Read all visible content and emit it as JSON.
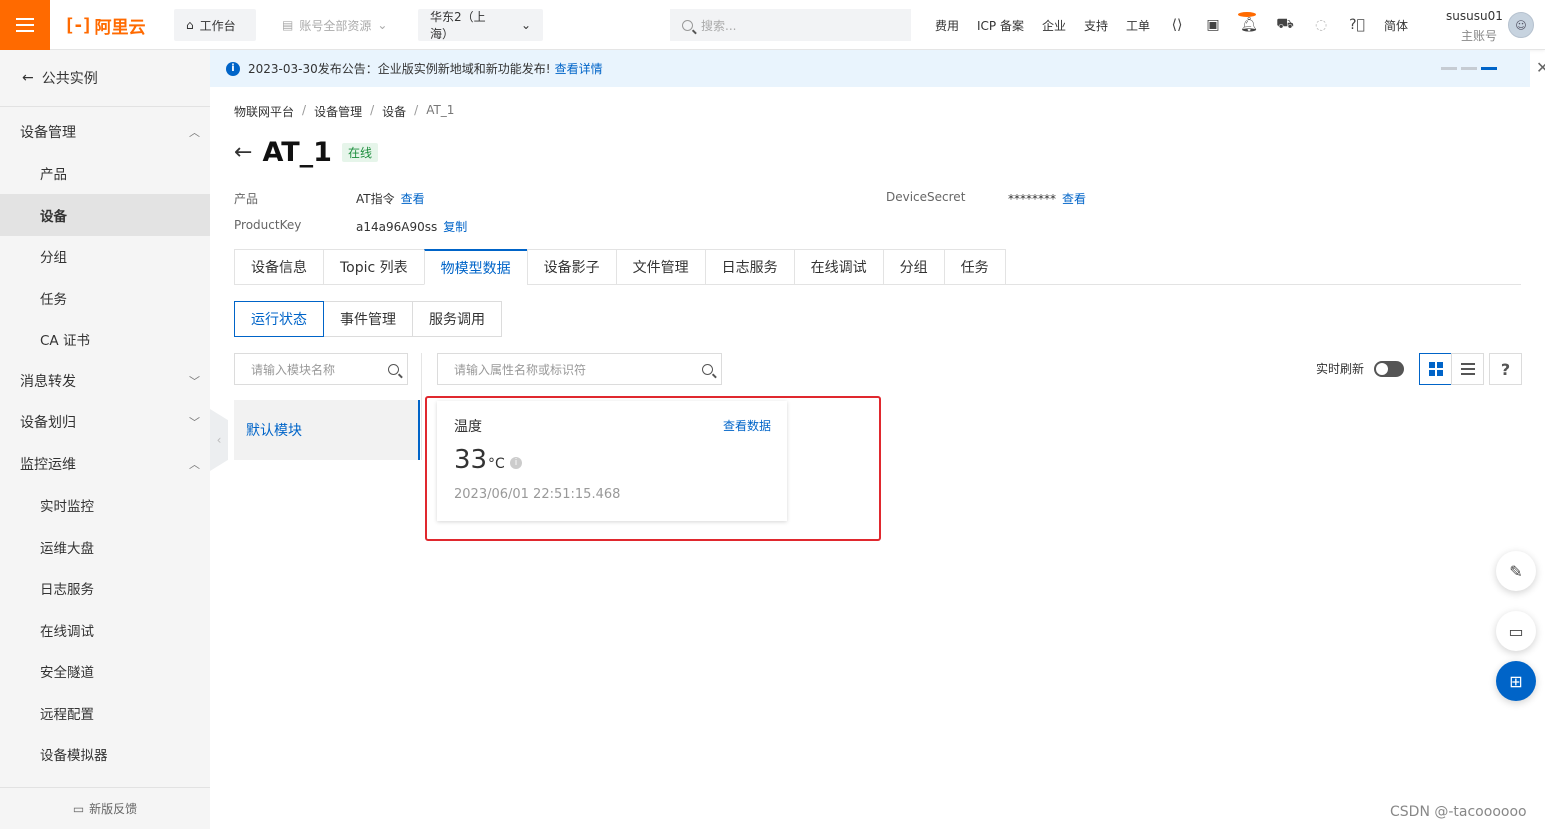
{
  "topbar": {
    "logo_text": "阿里云",
    "workbench": "工作台",
    "resource_group": "账号全部资源",
    "region": "华东2（上海）",
    "search_placeholder": "搜索...",
    "links": [
      "费用",
      "ICP 备案",
      "企业",
      "支持",
      "工单"
    ],
    "lang": "简体",
    "user_name": "sususu01",
    "user_role": "主账号"
  },
  "sidebar": {
    "back_label": "公共实例",
    "groups": [
      {
        "label": "设备管理",
        "expanded": true,
        "items": [
          "产品",
          "设备",
          "分组",
          "任务",
          "CA 证书"
        ]
      },
      {
        "label": "消息转发",
        "expanded": false,
        "items": []
      },
      {
        "label": "设备划归",
        "expanded": false,
        "items": []
      },
      {
        "label": "监控运维",
        "expanded": true,
        "items": [
          "实时监控",
          "运维大盘",
          "日志服务",
          "在线调试",
          "安全隧道",
          "远程配置",
          "设备模拟器"
        ]
      }
    ],
    "active_item": "设备",
    "feedback": "新版反馈"
  },
  "notice": {
    "text": "2023-03-30发布公告：企业版实例新地域和新功能发布!",
    "link": "查看详情"
  },
  "breadcrumb": [
    "物联网平台",
    "设备管理",
    "设备",
    "AT_1"
  ],
  "device": {
    "name": "AT_1",
    "status": "在线",
    "product_label": "产品",
    "product_value": "AT指令",
    "product_link": "查看",
    "productkey_label": "ProductKey",
    "productkey_value": "a14a96A90ss",
    "productkey_link": "复制",
    "secret_label": "DeviceSecret",
    "secret_value": "********",
    "secret_link": "查看"
  },
  "tabs": [
    "设备信息",
    "Topic 列表",
    "物模型数据",
    "设备影子",
    "文件管理",
    "日志服务",
    "在线调试",
    "分组",
    "任务"
  ],
  "active_tab": "物模型数据",
  "subtabs": [
    "运行状态",
    "事件管理",
    "服务调用"
  ],
  "active_subtab": "运行状态",
  "module_search_placeholder": "请输入模块名称",
  "property_search_placeholder": "请输入属性名称或标识符",
  "module": "默认模块",
  "realtime_refresh": "实时刷新",
  "property_card": {
    "name": "温度",
    "view_link": "查看数据",
    "value": "33",
    "unit": "°C",
    "timestamp": "2023/06/01 22:51:15.468"
  },
  "watermark": "CSDN @-tacoooooo",
  "colors": {
    "brand": "#ff6a00",
    "primary": "#0064c8",
    "highlight": "#e0282e",
    "online": "#1e8e3e"
  }
}
